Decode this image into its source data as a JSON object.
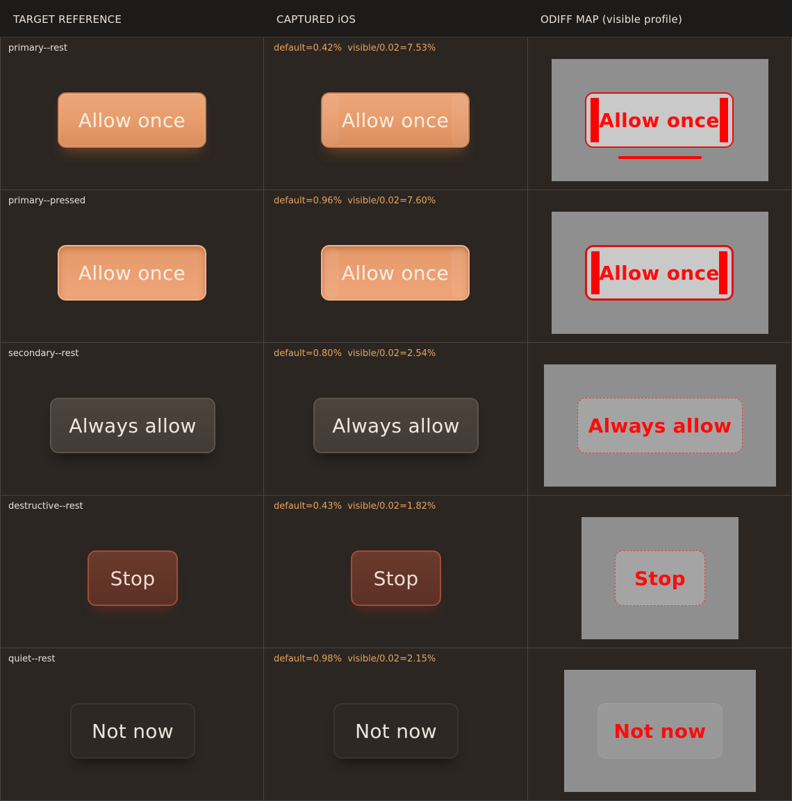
{
  "header": {
    "col_target": "TARGET REFERENCE",
    "col_captured": "CAPTURED iOS",
    "col_diff": "ODIFF MAP (visible profile)"
  },
  "colors": {
    "accent_primary": "#e59a6a",
    "metrics_text": "#e6a45f",
    "diff_red": "#ff0000"
  },
  "rows": [
    {
      "case": "primary--rest",
      "label": "Allow once",
      "metrics": "default=0.42%  visible/0.02=7.53%"
    },
    {
      "case": "primary--pressed",
      "label": "Allow once",
      "metrics": "default=0.96%  visible/0.02=7.60%"
    },
    {
      "case": "secondary--rest",
      "label": "Always allow",
      "metrics": "default=0.80%  visible/0.02=2.54%"
    },
    {
      "case": "destructive--rest",
      "label": "Stop",
      "metrics": "default=0.43%  visible/0.02=1.82%"
    },
    {
      "case": "quiet--rest",
      "label": "Not now",
      "metrics": "default=0.98%  visible/0.02=2.15%"
    }
  ]
}
